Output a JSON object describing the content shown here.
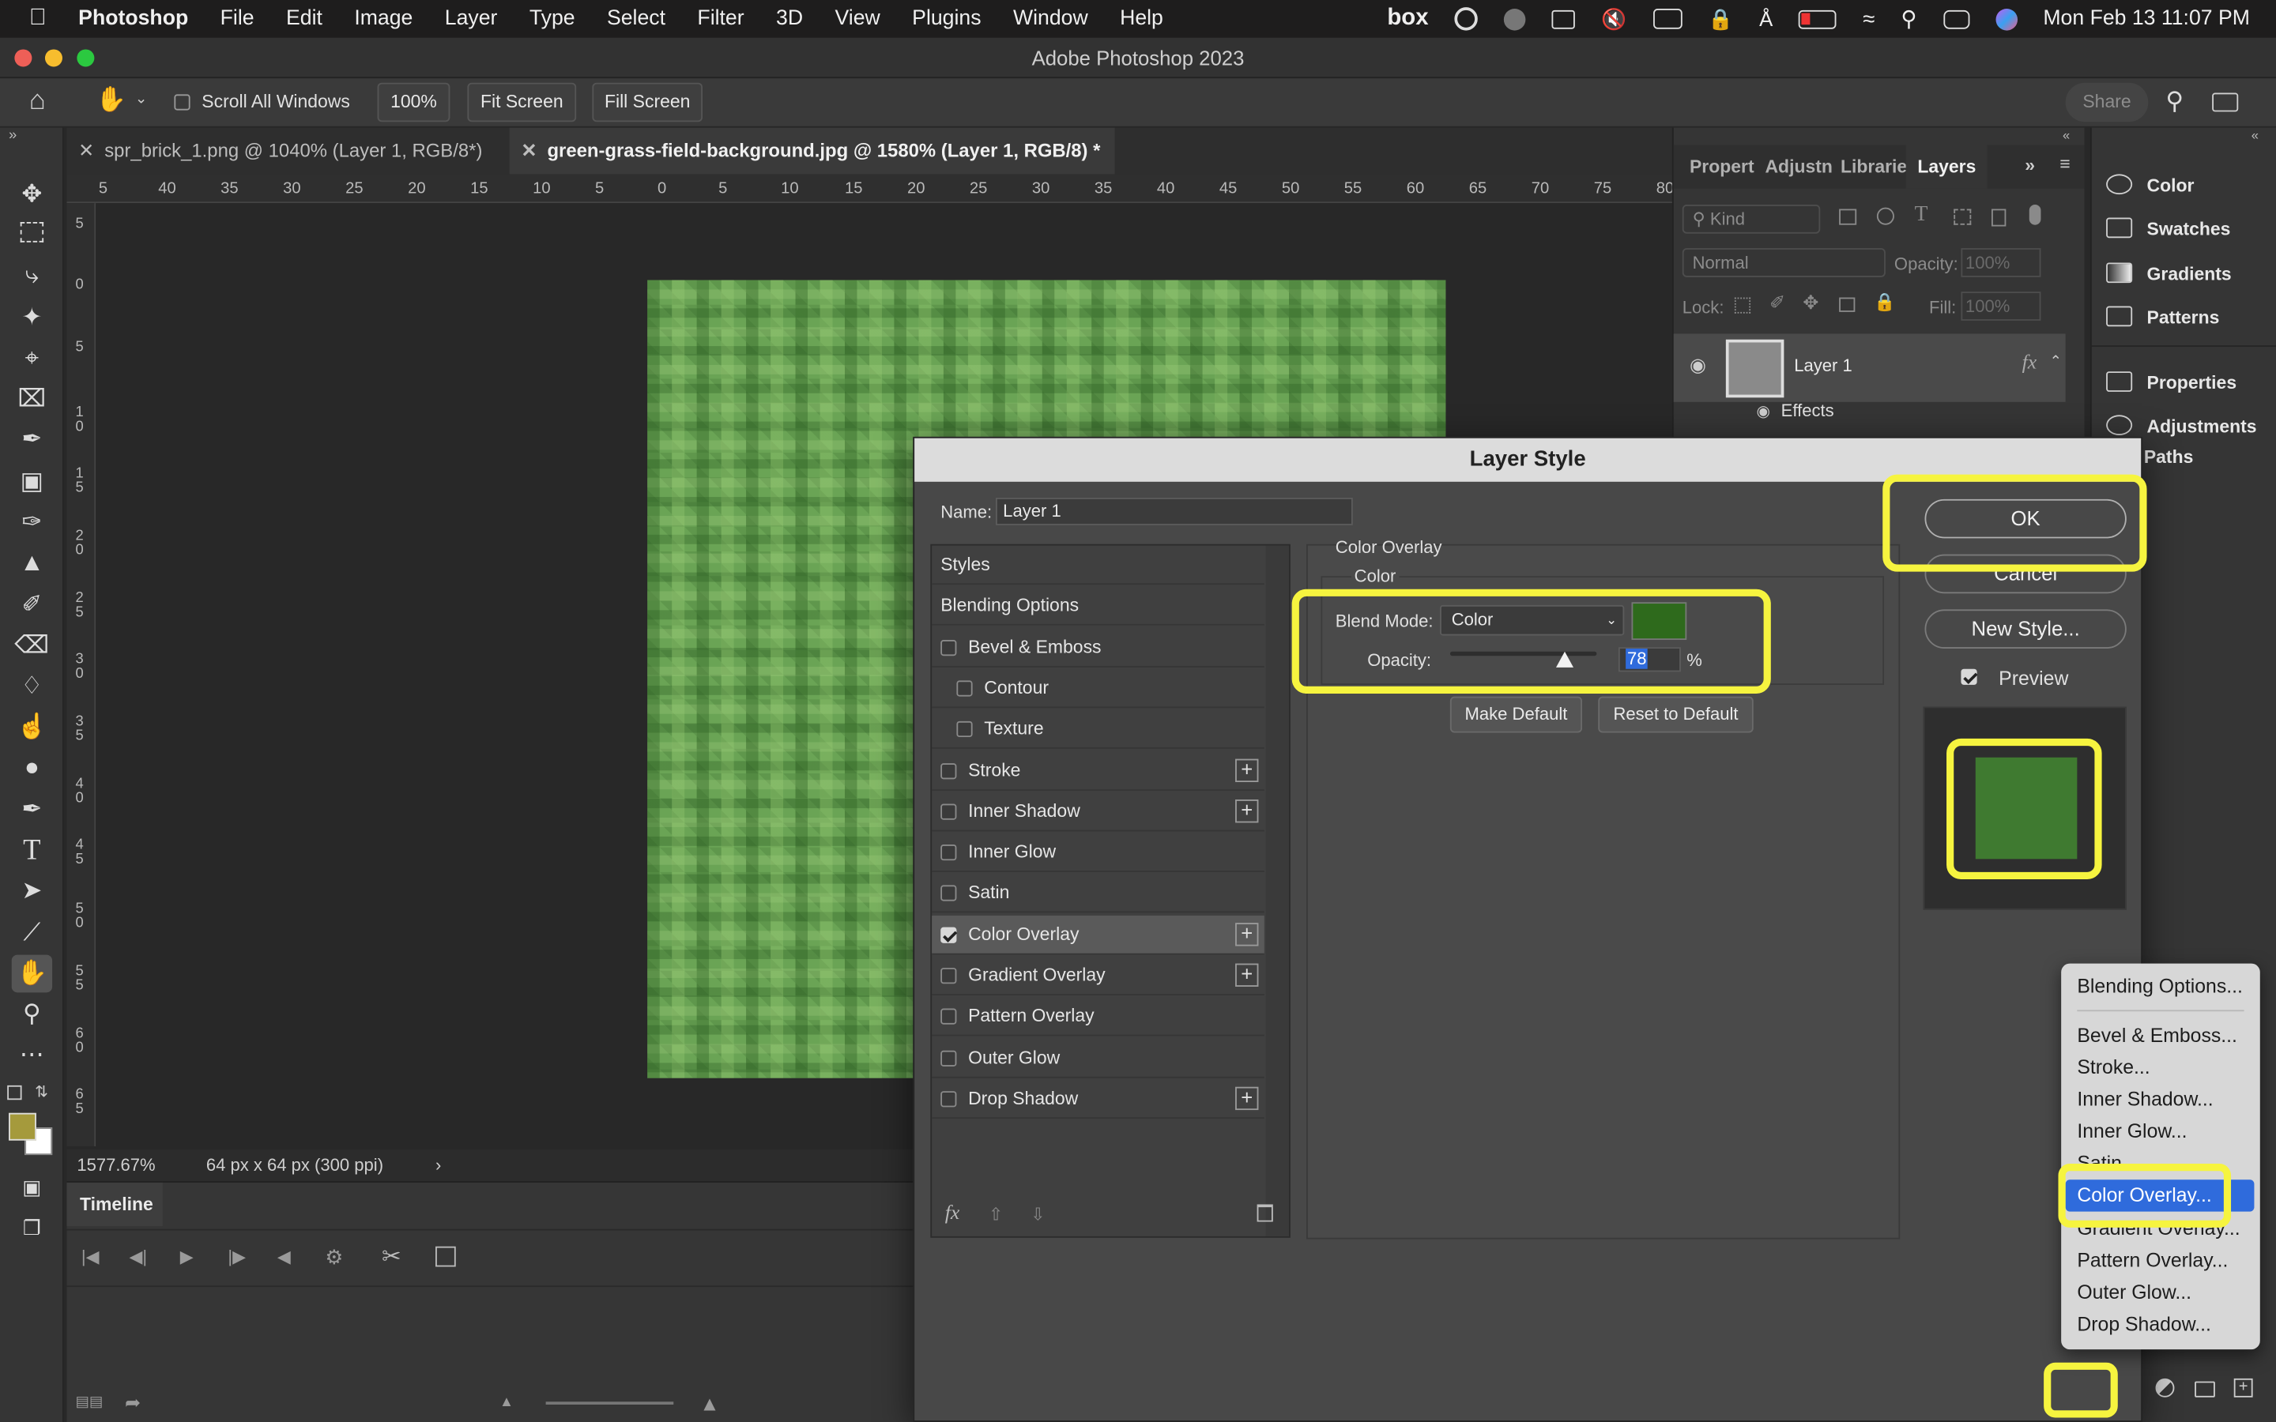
{
  "menubar": {
    "app": "Photoshop",
    "items": [
      "File",
      "Edit",
      "Image",
      "Layer",
      "Type",
      "Select",
      "Filter",
      "3D",
      "View",
      "Plugins",
      "Window",
      "Help"
    ],
    "box": "box",
    "datetime": "Mon Feb 13  11:07 PM"
  },
  "window": {
    "title": "Adobe Photoshop 2023"
  },
  "options": {
    "scroll_all": "Scroll All Windows",
    "zoom": "100%",
    "fit": "Fit Screen",
    "fill": "Fill Screen",
    "share": "Share"
  },
  "tabs": [
    {
      "label": "spr_brick_1.png @ 1040% (Layer 1, RGB/8*)"
    },
    {
      "label": "green-grass-field-background.jpg @ 1580% (Layer 1, RGB/8) *"
    }
  ],
  "ruler": {
    "h": [
      "5",
      "40",
      "35",
      "30",
      "25",
      "20",
      "15",
      "10",
      "5",
      "0",
      "5",
      "10",
      "15",
      "20",
      "25",
      "30",
      "35",
      "40",
      "45",
      "50",
      "55",
      "60",
      "65",
      "70",
      "75",
      "80"
    ],
    "v": [
      "5",
      "0",
      "5",
      "1 0",
      "1 5",
      "2 0",
      "2 5",
      "3 0",
      "3 5",
      "4 0",
      "4 5",
      "5 0",
      "5 5",
      "6 0",
      "6 5"
    ]
  },
  "status": {
    "zoom": "1577.67%",
    "size": "64 px x 64 px (300 ppi)"
  },
  "timeline": {
    "label": "Timeline"
  },
  "layers": {
    "tabs": [
      "Propert",
      "Adjustn",
      "Librarie",
      "Layers"
    ],
    "kind": "Kind",
    "blend": "Normal",
    "opacity_label": "Opacity:",
    "opacity": "100%",
    "lock": "Lock:",
    "fill_label": "Fill:",
    "fill": "100%",
    "layer_name": "Layer 1",
    "effects": "Effects",
    "fx": "fx"
  },
  "dock": {
    "items": [
      "Color",
      "Swatches",
      "Gradients",
      "Patterns",
      "Properties",
      "Adjustments",
      "Paths"
    ]
  },
  "dialog": {
    "title": "Layer Style",
    "name_label": "Name:",
    "name": "Layer 1",
    "styles": [
      {
        "label": "Styles",
        "check": false,
        "hasCheck": false,
        "plus": false
      },
      {
        "label": "Blending Options",
        "check": false,
        "hasCheck": false,
        "plus": false
      },
      {
        "label": "Bevel & Emboss",
        "check": false,
        "hasCheck": true,
        "plus": false
      },
      {
        "label": "Contour",
        "check": false,
        "hasCheck": true,
        "plus": false,
        "indent": true
      },
      {
        "label": "Texture",
        "check": false,
        "hasCheck": true,
        "plus": false,
        "indent": true
      },
      {
        "label": "Stroke",
        "check": false,
        "hasCheck": true,
        "plus": true
      },
      {
        "label": "Inner Shadow",
        "check": false,
        "hasCheck": true,
        "plus": true
      },
      {
        "label": "Inner Glow",
        "check": false,
        "hasCheck": true,
        "plus": false
      },
      {
        "label": "Satin",
        "check": false,
        "hasCheck": true,
        "plus": false
      },
      {
        "label": "Color Overlay",
        "check": true,
        "hasCheck": true,
        "plus": true,
        "selected": true
      },
      {
        "label": "Gradient Overlay",
        "check": false,
        "hasCheck": true,
        "plus": true
      },
      {
        "label": "Pattern Overlay",
        "check": false,
        "hasCheck": true,
        "plus": false
      },
      {
        "label": "Outer Glow",
        "check": false,
        "hasCheck": true,
        "plus": false
      },
      {
        "label": "Drop Shadow",
        "check": false,
        "hasCheck": true,
        "plus": true
      }
    ],
    "section": "Color Overlay",
    "sub": "Color",
    "blend_label": "Blend Mode:",
    "blend": "Color",
    "opacity_label": "Opacity:",
    "opacity": "78",
    "percent": "%",
    "opacity_value": 0.78,
    "overlay_color": "#2e6a1c",
    "make_default": "Make Default",
    "reset_default": "Reset to Default",
    "ok": "OK",
    "cancel": "Cancel",
    "new_style": "New Style...",
    "preview": "Preview",
    "preview_color": "#3f7a30",
    "fx": "fx"
  },
  "context_menu": {
    "items": [
      "Blending Options...",
      "Bevel & Emboss...",
      "Stroke...",
      "Inner Shadow...",
      "Inner Glow...",
      "Satin...",
      "Color Overlay...",
      "Gradient Overlay...",
      "Pattern Overlay...",
      "Outer Glow...",
      "Drop Shadow..."
    ],
    "selected": "Color Overlay..."
  },
  "colors": {
    "highlight": "#f6f43f",
    "accent": "#2f6bdc",
    "foreground": "#a59a3c"
  }
}
